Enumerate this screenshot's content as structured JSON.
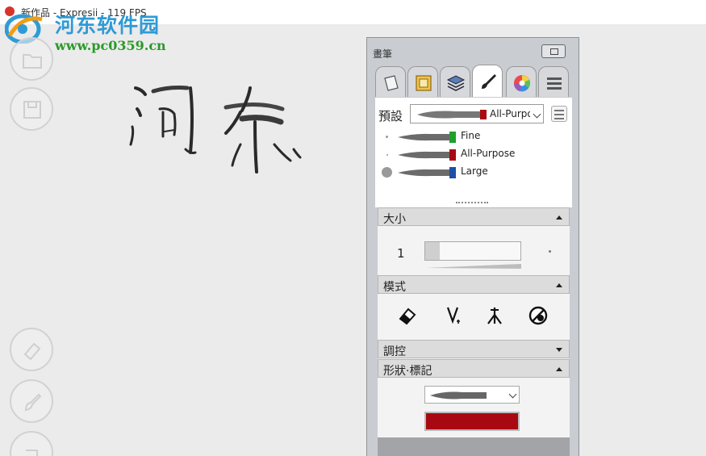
{
  "window": {
    "title": "新作品 - Expresii - 119 FPS"
  },
  "watermark": {
    "text": "河东软件园",
    "url": "www.pc0359.cn"
  },
  "left_tools": [
    {
      "icon": "open-folder-icon"
    },
    {
      "icon": "save-icon"
    },
    {
      "icon": "eraser-icon"
    },
    {
      "icon": "brush-icon"
    },
    {
      "icon": "undo-icon"
    }
  ],
  "panel": {
    "title": "畫筆",
    "tabs": [
      {
        "icon": "paper-icon"
      },
      {
        "icon": "canvas-frame-icon"
      },
      {
        "icon": "layers-icon"
      },
      {
        "icon": "brush-tab-icon",
        "active": true
      },
      {
        "icon": "color-wheel-icon"
      },
      {
        "icon": "menu-icon"
      }
    ],
    "presets": {
      "label": "預設",
      "selected": "All-Purpose",
      "items": [
        {
          "name": "Fine",
          "color": "#1fa02c"
        },
        {
          "name": "All-Purpose",
          "color": "#a80812"
        },
        {
          "name": "Large",
          "color": "#1d4fa8"
        }
      ]
    },
    "size": {
      "label": "大小",
      "value": "1",
      "level": 0.15
    },
    "mode": {
      "label": "模式",
      "icons": [
        "eraser-mode-icon",
        "pen-mode-icon",
        "split-brush-icon",
        "disable-icon"
      ]
    },
    "control": {
      "label": "調控"
    },
    "shape": {
      "label": "形狀·標記",
      "color": "#a80812"
    }
  }
}
